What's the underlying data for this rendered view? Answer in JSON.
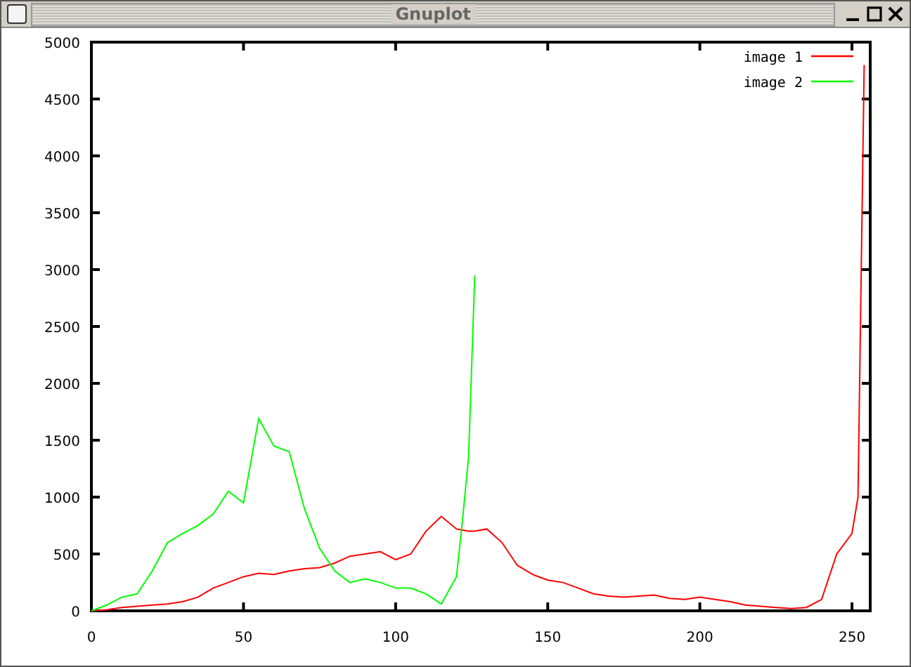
{
  "window": {
    "title": "Gnuplot"
  },
  "chart_data": {
    "type": "line",
    "x": [
      0,
      5,
      10,
      15,
      20,
      25,
      30,
      35,
      40,
      45,
      50,
      55,
      60,
      65,
      70,
      75,
      80,
      85,
      90,
      95,
      100,
      105,
      110,
      115,
      120,
      122,
      124,
      126,
      130,
      135,
      140,
      145,
      150,
      155,
      160,
      165,
      170,
      175,
      180,
      185,
      190,
      195,
      200,
      205,
      210,
      215,
      220,
      225,
      230,
      235,
      240,
      245,
      250,
      252,
      254
    ],
    "series": [
      {
        "name": "image 1",
        "color": "#ff0000",
        "values": [
          0,
          10,
          30,
          40,
          50,
          60,
          80,
          120,
          200,
          250,
          300,
          330,
          320,
          350,
          370,
          380,
          420,
          480,
          500,
          520,
          450,
          500,
          700,
          830,
          720,
          710,
          700,
          700,
          720,
          600,
          400,
          320,
          270,
          250,
          200,
          150,
          130,
          120,
          130,
          140,
          110,
          100,
          120,
          100,
          80,
          50,
          40,
          30,
          20,
          30,
          100,
          500,
          680,
          1000,
          4800
        ]
      },
      {
        "name": "image 2",
        "color": "#00ff00",
        "values": [
          0,
          50,
          120,
          150,
          350,
          600,
          680,
          750,
          850,
          1050,
          950,
          1690,
          1450,
          1400,
          900,
          550,
          350,
          250,
          280,
          250,
          200,
          200,
          150,
          60,
          300,
          800,
          1350,
          2950,
          null,
          null,
          null,
          null,
          null,
          null,
          null,
          null,
          null,
          null,
          null,
          null,
          null,
          null,
          null,
          null,
          null,
          null,
          null,
          null,
          null,
          null,
          null,
          null,
          null,
          null,
          null
        ]
      }
    ],
    "xlim": [
      0,
      256
    ],
    "ylim": [
      0,
      5000
    ],
    "xticks": [
      0,
      50,
      100,
      150,
      200,
      250
    ],
    "yticks": [
      0,
      500,
      1000,
      1500,
      2000,
      2500,
      3000,
      3500,
      4000,
      4500,
      5000
    ],
    "legend": true
  }
}
